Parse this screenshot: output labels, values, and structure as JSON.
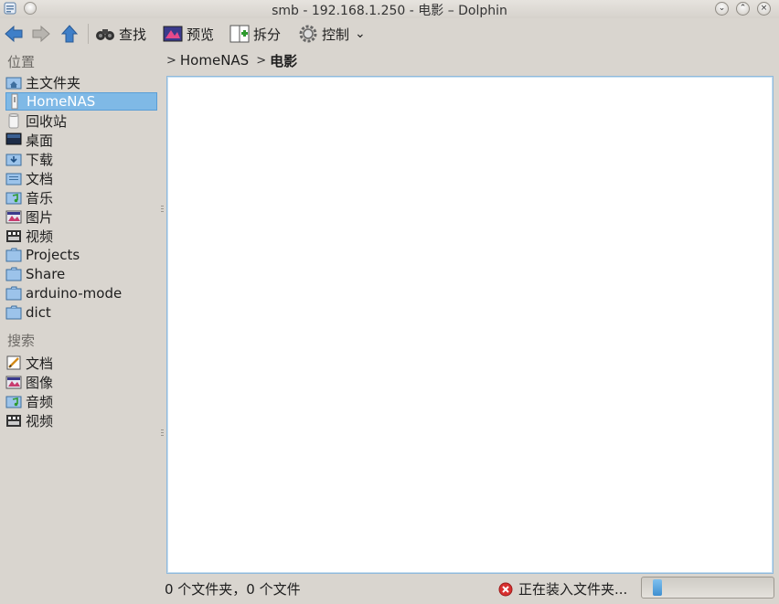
{
  "window": {
    "title": "smb - 192.168.1.250 - 电影 – Dolphin"
  },
  "toolbar": {
    "find_label": "查找",
    "preview_label": "预览",
    "split_label": "拆分",
    "control_label": "控制",
    "control_arrow": "⌄"
  },
  "sidebar": {
    "places_header": "位置",
    "places": [
      {
        "label": "主文件夹",
        "icon": "home-folder-icon"
      },
      {
        "label": "HomeNAS",
        "icon": "network-drive-icon",
        "selected": true
      },
      {
        "label": "回收站",
        "icon": "trash-icon"
      },
      {
        "label": "桌面",
        "icon": "desktop-icon"
      },
      {
        "label": "下载",
        "icon": "downloads-folder-icon"
      },
      {
        "label": "文档",
        "icon": "documents-folder-icon"
      },
      {
        "label": "音乐",
        "icon": "music-folder-icon"
      },
      {
        "label": "图片",
        "icon": "pictures-folder-icon"
      },
      {
        "label": "视频",
        "icon": "videos-folder-icon"
      },
      {
        "label": "Projects",
        "icon": "folder-icon"
      },
      {
        "label": "Share",
        "icon": "folder-icon"
      },
      {
        "label": "arduino-mode",
        "icon": "folder-icon"
      },
      {
        "label": "dict",
        "icon": "folder-icon"
      }
    ],
    "search_header": "搜索",
    "search": [
      {
        "label": "文档",
        "icon": "document-search-icon"
      },
      {
        "label": "图像",
        "icon": "image-search-icon"
      },
      {
        "label": "音频",
        "icon": "audio-search-icon"
      },
      {
        "label": "视频",
        "icon": "video-search-icon"
      }
    ]
  },
  "breadcrumb": {
    "parent": "HomeNAS",
    "current": "电影"
  },
  "status": {
    "summary": "0 个文件夹，0 个文件",
    "loading": "正在装入文件夹...",
    "progress": 0.08
  },
  "colors": {
    "selection": "#7fb9e6",
    "background": "#d9d5cf",
    "view_border": "#8fb9dc"
  }
}
